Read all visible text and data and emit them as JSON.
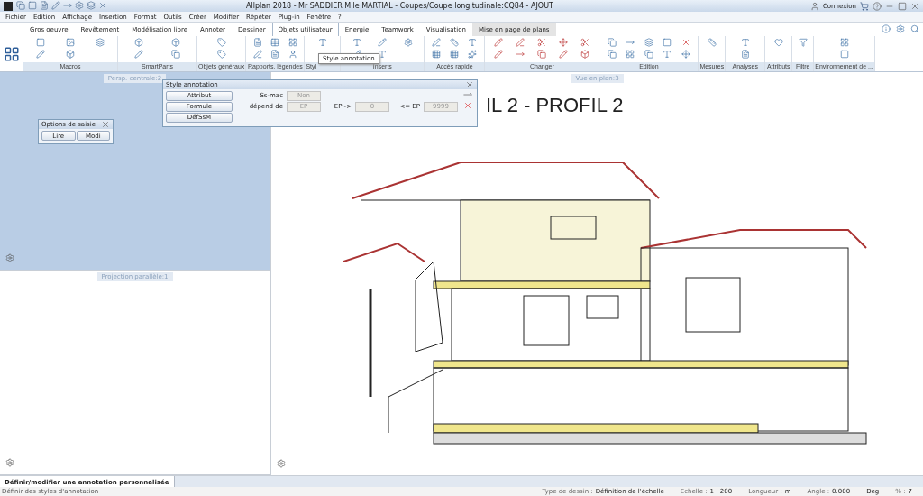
{
  "window": {
    "title": "Allplan 2018 - Mr SADDIER Mlle MARTIAL - Coupes/Coupe longitudinale:CQ84 - AJOUT",
    "account": "Connexion"
  },
  "menu": [
    "Fichier",
    "Edition",
    "Affichage",
    "Insertion",
    "Format",
    "Outils",
    "Créer",
    "Modifier",
    "Répéter",
    "Plug-in",
    "Fenêtre",
    "?"
  ],
  "tabs": [
    {
      "label": "Gros oeuvre",
      "selected": false,
      "shaded": false
    },
    {
      "label": "Revêtement",
      "selected": false,
      "shaded": false
    },
    {
      "label": "Modélisation libre",
      "selected": false,
      "shaded": false
    },
    {
      "label": "Annoter",
      "selected": false,
      "shaded": false
    },
    {
      "label": "Dessiner",
      "selected": false,
      "shaded": false
    },
    {
      "label": "Objets utilisateur",
      "selected": true,
      "shaded": false
    },
    {
      "label": "Energie",
      "selected": false,
      "shaded": false
    },
    {
      "label": "Teamwork",
      "selected": false,
      "shaded": false
    },
    {
      "label": "Visualisation",
      "selected": false,
      "shaded": false
    },
    {
      "label": "Mise en page de plans",
      "selected": false,
      "shaded": true
    }
  ],
  "ribbon_groups": [
    "Macros",
    "SmartParts",
    "Objets généraux",
    "Rapports, légendes",
    "Styl",
    "Inserts",
    "Accès rapide",
    "Changer",
    "Edition",
    "Mesures",
    "Analyses",
    "Attributs",
    "Filtre",
    "Environnement de ..."
  ],
  "tooltip": "Style annotation",
  "viewports": [
    {
      "title": "Persp. centrale:2"
    },
    {
      "title": "Projection parallèle:1"
    },
    {
      "title": "Vue en plan:3"
    }
  ],
  "drawing_title": "IL 2 - PROFIL 2",
  "options_dialog": {
    "title": "Options de saisie",
    "buttons": [
      "Lire",
      "Modi"
    ]
  },
  "style_dialog": {
    "title": "Style annotation",
    "buttons": [
      "Attribut",
      "Formule",
      "DéfSsM"
    ],
    "rows": [
      {
        "label": "Ss-mac",
        "field": "Non",
        "disabled": true
      },
      {
        "label": "dépend de",
        "field": "EP",
        "disabled": true,
        "from_label": "EP ->",
        "from_field": "0",
        "to_label": "<= EP",
        "to_field": "9999"
      }
    ]
  },
  "prompt_tab": "Définir/modifier une annotation personnalisée",
  "status_bar": {
    "message": "Définir des styles d'annotation",
    "items": [
      {
        "label": "Type de dessin :",
        "value": "Définition de l'échelle"
      },
      {
        "label": "Echelle :",
        "value": "1 : 200"
      },
      {
        "label": "Longueur :",
        "value": "m"
      },
      {
        "label": "Angle :",
        "value": "0.000"
      },
      {
        "value": "Deg"
      },
      {
        "label": "% :",
        "value": "7"
      }
    ]
  }
}
